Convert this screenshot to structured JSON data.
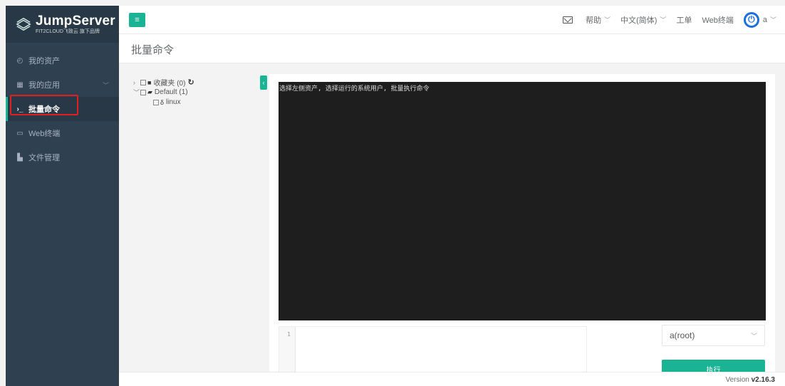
{
  "app": {
    "logo_title": "JumpServer",
    "logo_subtitle": "FIT2CLOUD飞致云 旗下品牌",
    "brand_color": "#1ab394",
    "sidebar_color": "#2f4050"
  },
  "sidebar": {
    "items": [
      {
        "label": "我的资产",
        "icon": "asset-icon",
        "glyph": "◴"
      },
      {
        "label": "我的应用",
        "icon": "grid-icon",
        "glyph": "▦",
        "caret": "﹀"
      },
      {
        "label": "批量命令",
        "icon": "terminal-prompt-icon",
        "glyph": "›_",
        "active": true
      },
      {
        "label": "Web终端",
        "icon": "window-icon",
        "glyph": "▭"
      },
      {
        "label": "文件管理",
        "icon": "file-icon",
        "glyph": "▙"
      }
    ]
  },
  "topbar": {
    "help": "帮助",
    "language": "中文(简体)",
    "tickets": "工单",
    "web_terminal": "Web终端",
    "user": "a"
  },
  "page": {
    "title": "批量命令"
  },
  "tree": {
    "favorites": "收藏夹 (0)",
    "default_node": "Default (1)",
    "asset": "linux"
  },
  "terminal": {
    "text": "选择左侧资产, 选择运行的系统用户, 批量执行命令"
  },
  "editor": {
    "line_number": "1"
  },
  "system_user_select": {
    "value": "a(root)"
  },
  "run_button": "执行",
  "footer": {
    "version_label": "Version",
    "version": "v2.16.3"
  }
}
